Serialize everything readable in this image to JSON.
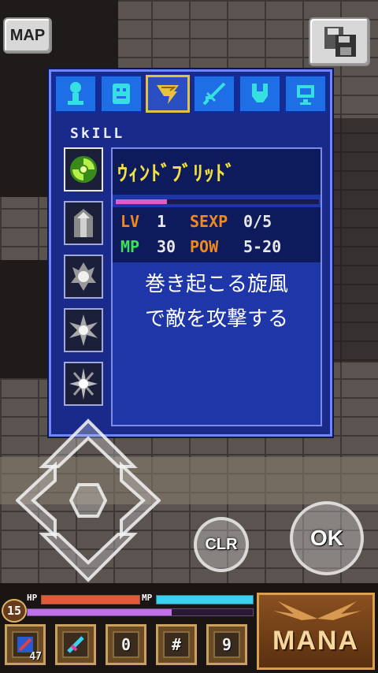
{
  "hud_top": {
    "map_label": "MAP",
    "save_icon": "floppy-disk-icon"
  },
  "panel": {
    "tabs": [
      {
        "icon": "character-icon"
      },
      {
        "icon": "armor-icon"
      },
      {
        "icon": "skill-tornado-icon",
        "active": true
      },
      {
        "icon": "sword-icon"
      },
      {
        "icon": "gauntlet-icon"
      },
      {
        "icon": "monitor-icon"
      }
    ],
    "section_label": "SkILL",
    "skill_slots": [
      {
        "icon": "wind-bullet-skill-icon"
      },
      {
        "icon": "pillar-skill-icon"
      },
      {
        "icon": "flame-skill-icon"
      },
      {
        "icon": "spike-skill-icon"
      },
      {
        "icon": "burst-skill-icon"
      }
    ],
    "selected_skill": {
      "name": "ｳｨﾝﾄﾞﾌﾞﾘｯﾄﾞ",
      "exp_fill_fraction": 0.25,
      "lv_label": "LV",
      "lv_value": "1",
      "sexp_label": "SEXP",
      "sexp_value": "0/5",
      "mp_label": "MP",
      "mp_value": "30",
      "pow_label": "POW",
      "pow_value": "5-20",
      "description_line1": "巻き起こる旋風",
      "description_line2": "で敵を攻撃する"
    }
  },
  "controls": {
    "clr_label": "CLR",
    "ok_label": "OK"
  },
  "hud": {
    "level": "15",
    "hp_label": "HP",
    "mp_label": "MP",
    "hp_fraction": 1.0,
    "mp_fraction": 1.0,
    "exp_fraction": 0.64,
    "items": [
      {
        "icon": "potion-item-icon",
        "count": "47"
      },
      {
        "icon": "gem-item-icon",
        "count": ""
      },
      {
        "icon": "slot-0-icon",
        "label": "0"
      },
      {
        "icon": "slot-hash-icon",
        "label": "#"
      },
      {
        "icon": "slot-9-icon",
        "label": "9"
      }
    ],
    "mana_label": "MANA"
  },
  "colors": {
    "panel_bg": "#1a2a8a",
    "skill_name": "#f2e040",
    "stat_label_orange": "#f08a1e",
    "stat_label_green": "#3ee05a",
    "hp_bar": "#e25a3a",
    "mp_bar": "#3ad0f0",
    "exp_bar": "#c070e8"
  }
}
